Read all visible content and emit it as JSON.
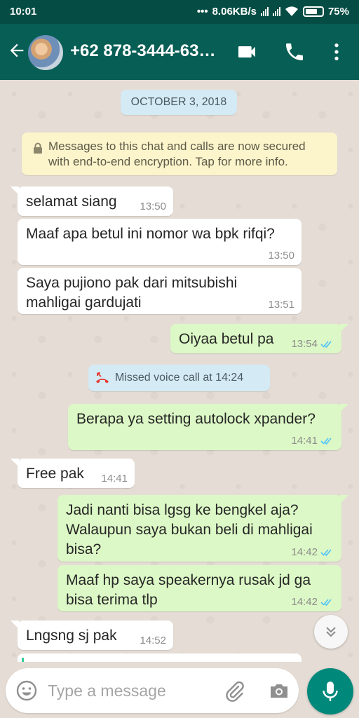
{
  "status_bar": {
    "time": "10:01",
    "network_speed": "8.06KB/s",
    "battery": "75%"
  },
  "header": {
    "contact_name": "+62 878-3444-63…",
    "icons": [
      "back-arrow-icon",
      "video-call-icon",
      "voice-call-icon",
      "more-options-icon"
    ]
  },
  "chat": {
    "date": "OCTOBER 3, 2018",
    "encryption_notice": "Messages to this chat and calls are now secured with end-to-end encryption. Tap for more info.",
    "missed_call": "Missed voice call at 14:24",
    "messages": [
      {
        "direction": "in",
        "text": "selamat siang",
        "time": "13:50"
      },
      {
        "direction": "in",
        "text": "Maaf apa betul ini nomor wa bpk rifqi?",
        "time": "13:50"
      },
      {
        "direction": "in",
        "text": "Saya pujiono pak dari mitsubishi mahligai gardujati",
        "time": "13:51"
      },
      {
        "direction": "out",
        "text": "Oiyaa betul pa",
        "time": "13:54",
        "status": "read"
      },
      {
        "direction": "out",
        "text": "Berapa ya setting autolock xpander?",
        "time": "14:41",
        "status": "read"
      },
      {
        "direction": "in",
        "text": "Free pak",
        "time": "14:41"
      },
      {
        "direction": "out",
        "text": "Jadi nanti bisa lgsg ke bengkel aja? Walaupun saya bukan beli di mahligai bisa?",
        "time": "14:42",
        "status": "read"
      },
      {
        "direction": "out",
        "text": "Maaf hp saya speakernya rusak jd ga bisa terima tlp",
        "time": "14:42",
        "status": "read"
      },
      {
        "direction": "in",
        "text": "Lngsng sj pak",
        "time": "14:52"
      }
    ]
  },
  "composer": {
    "placeholder": "Type a message",
    "value": ""
  },
  "colors": {
    "header": "#075e54",
    "status_bar": "#054d44",
    "outgoing_bubble": "#dcf8c6",
    "incoming_bubble": "#ffffff",
    "read_ticks": "#4fc3f7",
    "mic_button": "#00897b"
  }
}
